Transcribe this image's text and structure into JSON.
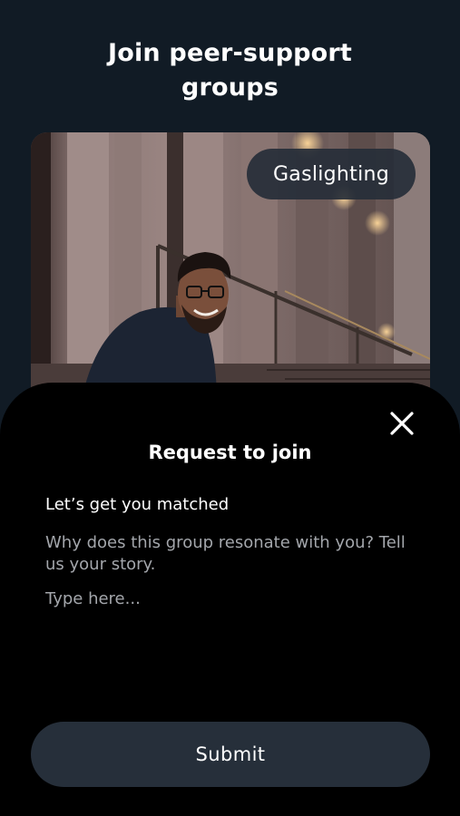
{
  "header": {
    "title_line1": "Join peer-support",
    "title_line2": "groups"
  },
  "group_card": {
    "tag": "Gaslighting",
    "photo_icon": "photo-laughing-man"
  },
  "sheet": {
    "close_icon": "close-icon",
    "title": "Request to join",
    "subtitle": "Let’s get you matched",
    "prompt": "Why does this group resonate with you? Tell us your story.",
    "input_placeholder": "Type here...",
    "input_value": "",
    "submit_label": "Submit"
  },
  "colors": {
    "background": "#111b25",
    "sheet": "#000000",
    "chip": "#262e38",
    "button": "#262f3a",
    "muted_text": "#a3a6ab"
  }
}
